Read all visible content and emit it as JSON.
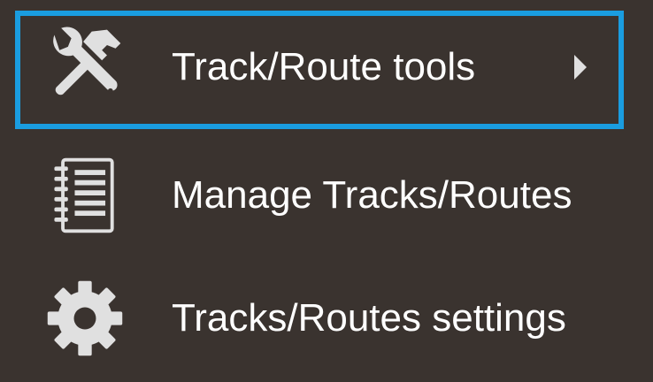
{
  "menu": {
    "items": [
      {
        "label": "Track/Route tools",
        "icon": "tools-icon",
        "has_submenu": true,
        "selected": true
      },
      {
        "label": "Manage Tracks/Routes",
        "icon": "notebook-icon",
        "has_submenu": false,
        "selected": false
      },
      {
        "label": "Tracks/Routes settings",
        "icon": "gear-icon",
        "has_submenu": false,
        "selected": false
      }
    ]
  },
  "colors": {
    "background": "#3a332f",
    "text": "#ffffff",
    "icon": "#e0e0e0",
    "highlight": "#1a9de0"
  }
}
